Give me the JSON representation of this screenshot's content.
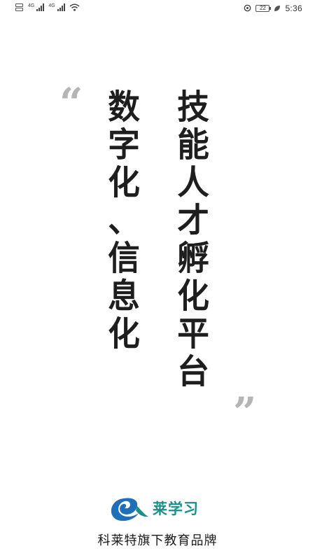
{
  "status_bar": {
    "network_1": "4G",
    "network_2": "4G",
    "battery": "22",
    "time": "5:36",
    "icons": [
      "sim-icon",
      "signal-icon",
      "wifi-icon",
      "location-icon",
      "battery-icon",
      "leaf-icon"
    ]
  },
  "slogan": {
    "quote_open": "“",
    "quote_close": "”",
    "left_column": [
      "数",
      "字",
      "化",
      "、",
      "信",
      "息",
      "化"
    ],
    "right_column": [
      "技",
      "能",
      "人",
      "才",
      "孵",
      "化",
      "平",
      "台"
    ]
  },
  "footer": {
    "logo_name": "莱学习",
    "tagline": "科莱特旗下教育品牌"
  },
  "colors": {
    "brand_teal": "#1a8f8a",
    "brand_blue": "#1f6fb8",
    "quote_gray": "#b5b5b5",
    "text_dark": "#1e1e1e"
  }
}
